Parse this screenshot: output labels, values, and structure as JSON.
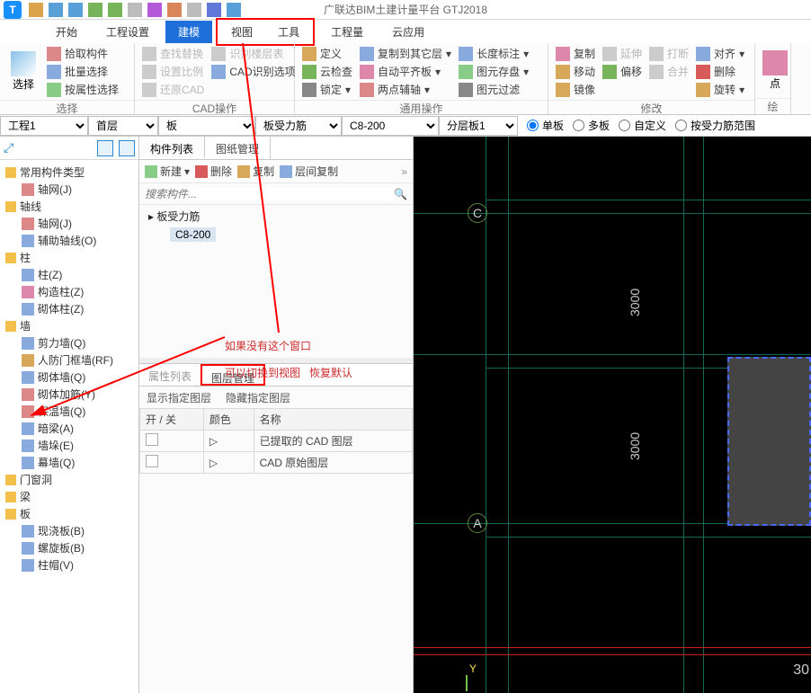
{
  "app": {
    "title": "广联达BIM土建计量平台 GTJ2018"
  },
  "menu": {
    "start": "开始",
    "engset": "工程设置",
    "model": "建模",
    "view": "视图",
    "tool": "工具",
    "engqty": "工程量",
    "cloud": "云应用"
  },
  "ribbon": {
    "sel_big": "选择",
    "pick": "拾取构件",
    "batch": "批量选择",
    "byprop": "按属性选择",
    "find": "查找替换",
    "setscale": "设置比例",
    "restorecad": "还原CAD",
    "recogtable": "识别楼层表",
    "cadopt": "CAD识别选项",
    "define": "定义",
    "yuncheck": "云检查",
    "lock": "锁定",
    "copyfloor": "复制到其它层",
    "auto": "自动平齐板",
    "aux": "两点辅轴",
    "lenmark": "长度标注",
    "yuancun": "图元存盘",
    "yuanfilt": "图元过滤",
    "copy": "复制",
    "move": "移动",
    "mirror": "镜像",
    "extend": "延伸",
    "offset": "偏移",
    "break": "打断",
    "align": "对齐",
    "merge": "合并",
    "del": "删除",
    "rotate": "旋转",
    "g1": "选择",
    "g2": "CAD操作",
    "g3": "通用操作",
    "g4": "修改",
    "pt": "点",
    "draw": "绘"
  },
  "sel": {
    "proj": "工程1",
    "floor": "首层",
    "type": "板",
    "sub": "板受力筋",
    "bar": "C8-200",
    "layer": "分层板1",
    "r1": "单板",
    "r2": "多板",
    "r3": "自定义",
    "r4": "按受力筋范围"
  },
  "tree": {
    "root": "常用构件类型",
    "n_axis": "轴网(J)",
    "g_axisline": "轴线",
    "n_axis2": "轴网(J)",
    "n_aux": "辅助轴线(O)",
    "g_col": "柱",
    "n_col": "柱(Z)",
    "n_ccol": "构造柱(Z)",
    "n_mcol": "砌体柱(Z)",
    "g_wall": "墙",
    "n_swall": "剪力墙(Q)",
    "n_rfwall": "人防门框墙(RF)",
    "n_mwall": "砌体墙(Q)",
    "n_mrein": "砌体加筋(Y)",
    "n_ins": "保温墙(Q)",
    "n_dbeam": "暗梁(A)",
    "n_wd": "墙垛(E)",
    "n_cwall": "幕墙(Q)",
    "g_door": "门窗洞",
    "g_beam": "梁",
    "g_slab": "板",
    "n_cslab": "现浇板(B)",
    "n_spiral": "螺旋板(B)",
    "n_cap": "柱帽(V)"
  },
  "mid": {
    "tab1": "构件列表",
    "tab2": "图纸管理",
    "new": "新建",
    "del": "删除",
    "copy": "复制",
    "floorcopy": "层间复制",
    "search_ph": "搜索构件...",
    "li1": "板受力筋",
    "li2": "C8-200",
    "ptab1": "属性列表",
    "ptab2": "图层管理",
    "show": "显示指定图层",
    "hide": "隐藏指定图层",
    "th1": "开 / 关",
    "th2": "颜色",
    "th3": "名称",
    "row1": "已提取的 CAD 图层",
    "row2": "CAD 原始图层"
  },
  "annot": {
    "line1": "如果没有这个窗口",
    "line2": "可以切换到视图",
    "line3": "恢复默认"
  },
  "canvas": {
    "gA": "A",
    "gC": "C",
    "d1": "3000",
    "d2": "3000",
    "num": "30",
    "y": "Y"
  }
}
